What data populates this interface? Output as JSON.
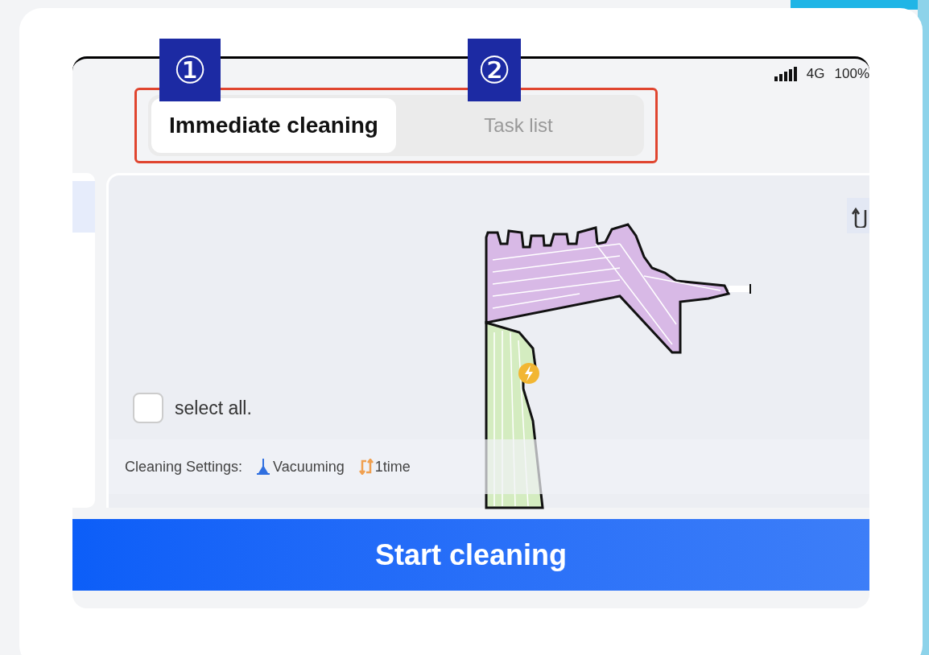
{
  "callouts": [
    "①",
    "②"
  ],
  "status_bar": {
    "network": "4G",
    "battery": "100%"
  },
  "tabs": [
    {
      "label": "Immediate cleaning",
      "selected": true
    },
    {
      "label": "Task list",
      "selected": false
    }
  ],
  "select_all": {
    "label": "select all.",
    "checked": false
  },
  "cleaning_settings": {
    "label": "Cleaning Settings:",
    "mode": "Vacuuming",
    "times": "1time"
  },
  "start_button": "Start cleaning"
}
